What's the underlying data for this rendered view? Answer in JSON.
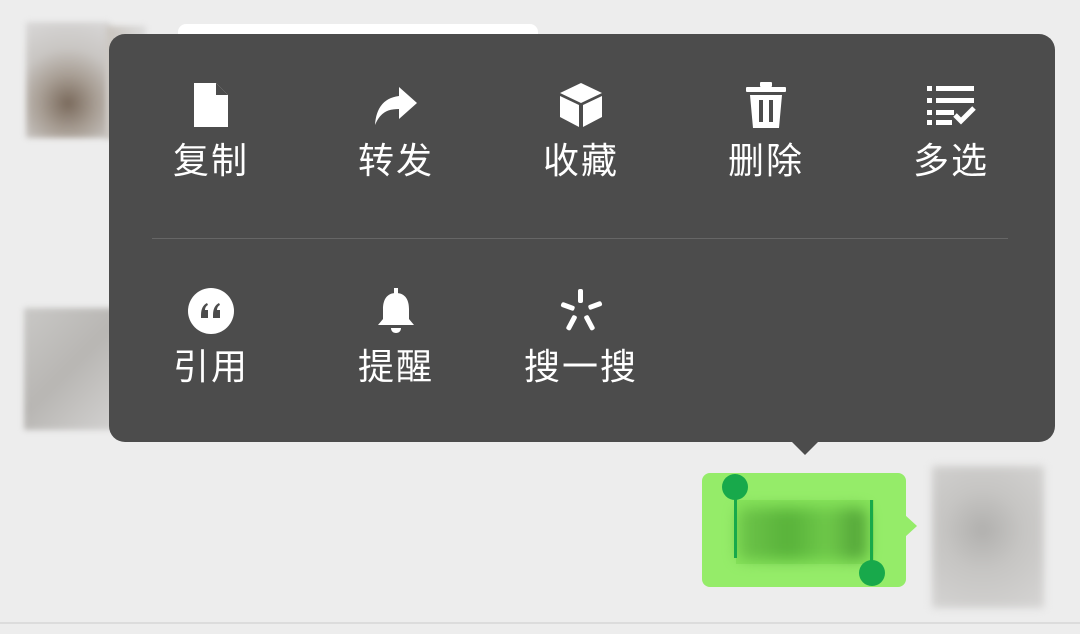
{
  "menu": {
    "row1": [
      {
        "id": "copy",
        "label": "复制",
        "icon": "document-icon"
      },
      {
        "id": "forward",
        "label": "转发",
        "icon": "share-arrow-icon"
      },
      {
        "id": "favorite",
        "label": "收藏",
        "icon": "cube-icon"
      },
      {
        "id": "delete",
        "label": "删除",
        "icon": "trash-icon"
      },
      {
        "id": "multiselect",
        "label": "多选",
        "icon": "checklist-icon"
      }
    ],
    "row2": [
      {
        "id": "quote",
        "label": "引用",
        "icon": "quote-icon"
      },
      {
        "id": "remind",
        "label": "提醒",
        "icon": "bell-icon"
      },
      {
        "id": "search",
        "label": "搜一搜",
        "icon": "search-spark-icon"
      }
    ]
  },
  "colors": {
    "menu_background": "#4c4c4c",
    "selected_bubble": "#95ec69",
    "selection_handle": "#18a94b",
    "chat_background": "#ededed"
  }
}
